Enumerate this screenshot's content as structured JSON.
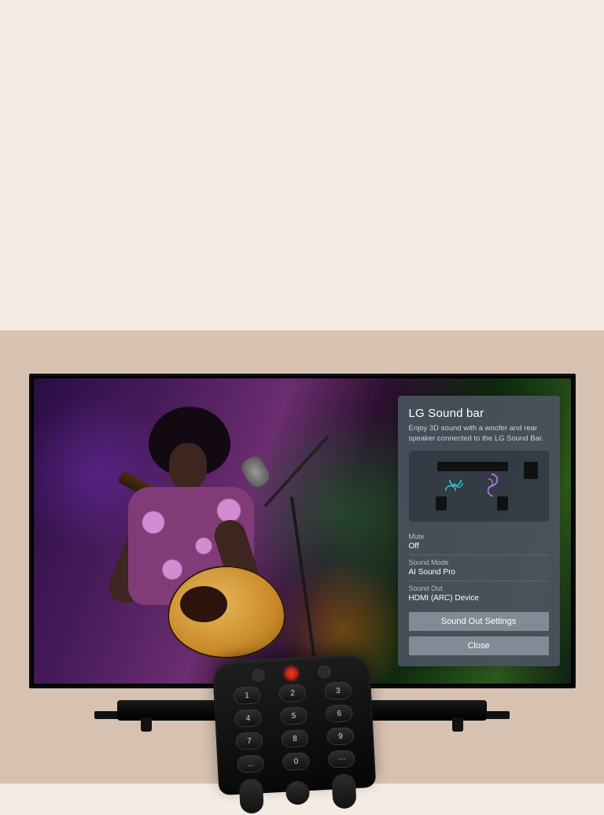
{
  "panel": {
    "title": "LG Sound bar",
    "description": "Enjoy 3D sound with a woofer and rear speaker connected to the LG Sound Bar.",
    "rows": {
      "mute": {
        "label": "Mute",
        "value": "Off"
      },
      "soundMode": {
        "label": "Sound Mode",
        "value": "AI Sound Pro"
      },
      "soundOut": {
        "label": "Sound Out",
        "value": "HDMI (ARC) Device"
      }
    },
    "buttons": {
      "settings": "Sound Out Settings",
      "close": "Close"
    }
  },
  "remote": {
    "keys": [
      "1",
      "2",
      "3",
      "4",
      "5",
      "6",
      "7",
      "8",
      "9",
      "…",
      "0",
      "⋯"
    ]
  },
  "icons": {
    "power": "power-icon",
    "mic": "mic-icon"
  }
}
